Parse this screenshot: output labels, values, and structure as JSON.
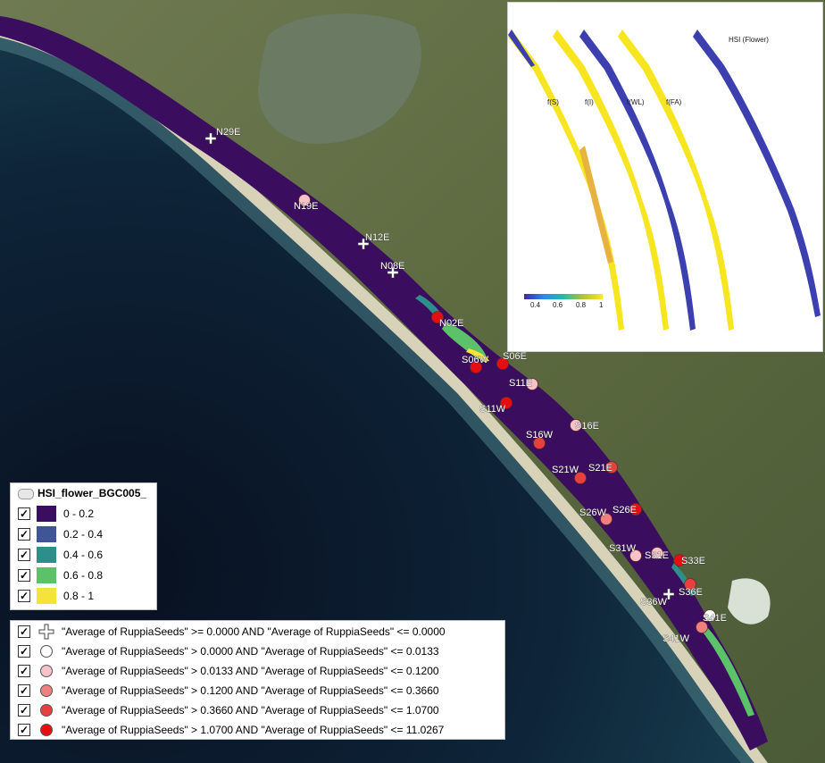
{
  "raster_legend": {
    "title": "HSI_flower_BGC005_",
    "classes": [
      {
        "label": "0 - 0.2",
        "color": "#3b0d5e"
      },
      {
        "label": "0.2 - 0.4",
        "color": "#3f5597"
      },
      {
        "label": "0.4 - 0.6",
        "color": "#2c8f8a"
      },
      {
        "label": "0.6 - 0.8",
        "color": "#5cc26a"
      },
      {
        "label": "0.8 - 1",
        "color": "#f5e33a"
      }
    ]
  },
  "point_legend": {
    "classes": [
      {
        "label": "\"Average of RuppiaSeeds\" >= 0.0000 AND \"Average of RuppiaSeeds\" <= 0.0000",
        "symbol": "cross",
        "color": "#ffffff"
      },
      {
        "label": "\"Average of RuppiaSeeds\" > 0.0000 AND \"Average of RuppiaSeeds\" <= 0.0133",
        "symbol": "circle",
        "color": "#ffffff"
      },
      {
        "label": "\"Average of RuppiaSeeds\" > 0.0133 AND \"Average of RuppiaSeeds\" <= 0.1200",
        "symbol": "circle",
        "color": "#f7c2c8"
      },
      {
        "label": "\"Average of RuppiaSeeds\" > 0.1200 AND \"Average of RuppiaSeeds\" <= 0.3660",
        "symbol": "circle",
        "color": "#f08080"
      },
      {
        "label": "\"Average of RuppiaSeeds\" > 0.3660 AND \"Average of RuppiaSeeds\" <= 1.0700",
        "symbol": "circle",
        "color": "#e8403f"
      },
      {
        "label": "\"Average of RuppiaSeeds\" > 1.0700 AND \"Average of RuppiaSeeds\" <= 11.0267",
        "symbol": "circle",
        "color": "#e60f0f"
      }
    ]
  },
  "sites": [
    {
      "name": "N29E",
      "class": 0
    },
    {
      "name": "N19E",
      "class": 2
    },
    {
      "name": "N12E",
      "class": 0
    },
    {
      "name": "N08E",
      "class": 0
    },
    {
      "name": "N02E",
      "class": 5
    },
    {
      "name": "S06W",
      "class": 5
    },
    {
      "name": "S06E",
      "class": 5
    },
    {
      "name": "S11E",
      "class": 2
    },
    {
      "name": "S11W",
      "class": 5
    },
    {
      "name": "S16E",
      "class": 2
    },
    {
      "name": "S16W",
      "class": 4
    },
    {
      "name": "S21E",
      "class": 4
    },
    {
      "name": "S21W",
      "class": 4
    },
    {
      "name": "S26E",
      "class": 5
    },
    {
      "name": "S26W",
      "class": 3
    },
    {
      "name": "S31W",
      "class": 2
    },
    {
      "name": "S31E",
      "class": 2
    },
    {
      "name": "S33E",
      "class": 5
    },
    {
      "name": "S36E",
      "class": 4
    },
    {
      "name": "S36W",
      "class": 0
    },
    {
      "name": "S41E",
      "class": 1
    },
    {
      "name": "S41W",
      "class": 3
    }
  ],
  "inset": {
    "panels": [
      {
        "label": "f(S)"
      },
      {
        "label": "f(I)"
      },
      {
        "label": "f(WL)"
      },
      {
        "label": "f(FA)"
      },
      {
        "label": "HSI (Flower)"
      }
    ],
    "colorbar": {
      "ticks": [
        "0.4",
        "0.6",
        "0.8",
        "1"
      ]
    }
  }
}
